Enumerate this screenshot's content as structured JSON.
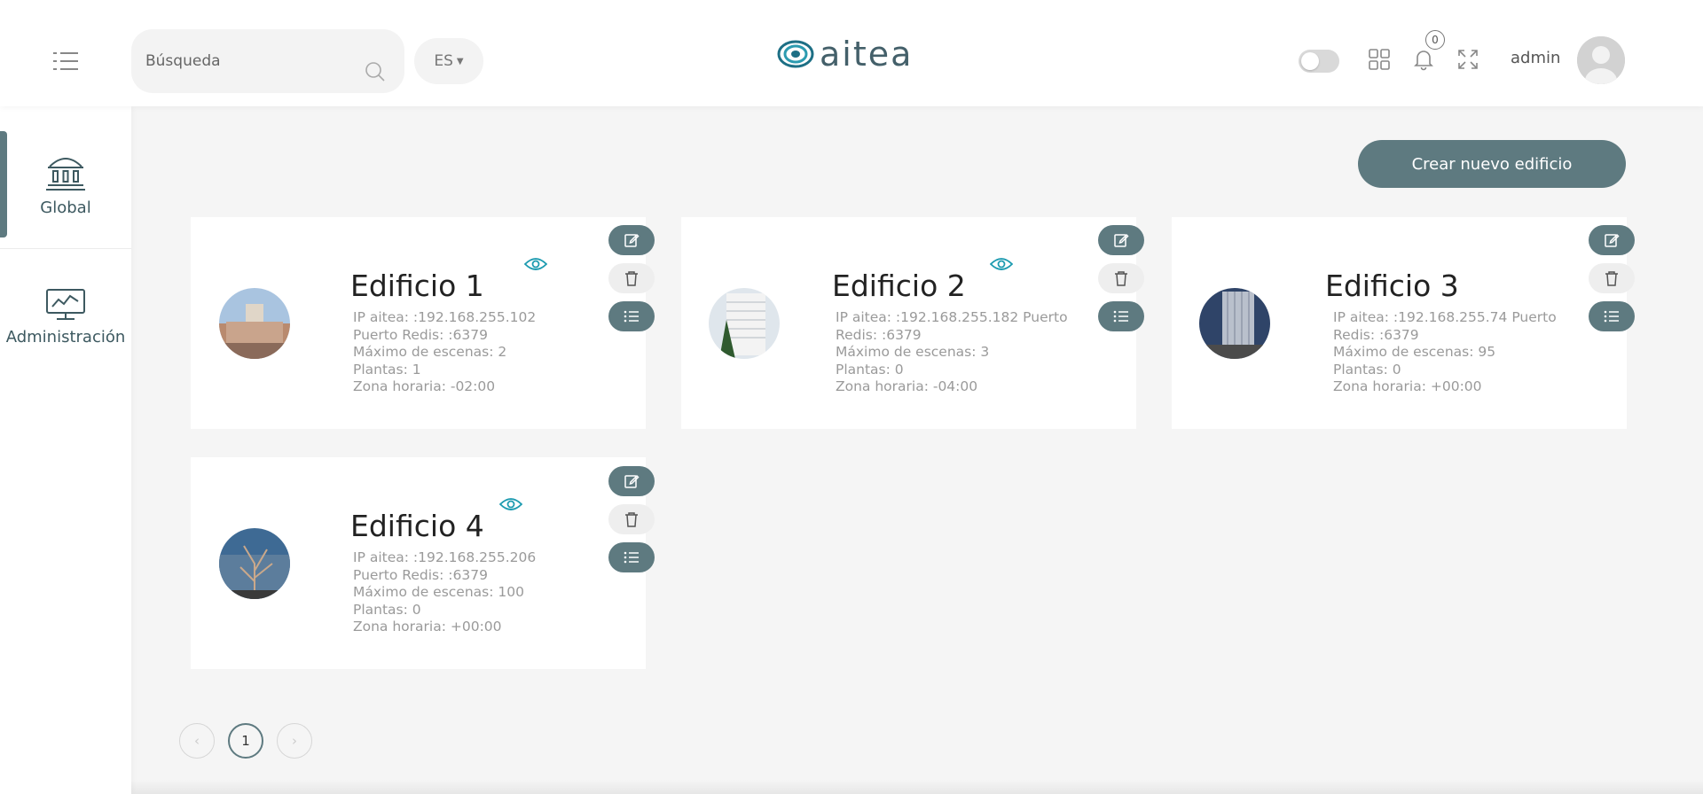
{
  "header": {
    "search": {
      "placeholder": "Búsqueda",
      "value": ""
    },
    "language": "ES",
    "logo_text": "aitea",
    "notifications_count": "0",
    "user_name": "admin",
    "icons": [
      "menu-toggle-icon",
      "search-icon",
      "caret-down-icon",
      "apps-grid-icon",
      "bell-icon",
      "fullscreen-icon",
      "user-avatar"
    ]
  },
  "sidebar": {
    "items": [
      {
        "label": "Global",
        "icon": "building-icon",
        "active": true
      },
      {
        "label": "Administración",
        "icon": "monitor-chart-icon",
        "active": false
      }
    ]
  },
  "main": {
    "create_button": "Crear nuevo edificio",
    "buildings": [
      {
        "name": "Edificio 1",
        "ip_line": "IP aitea: :192.168.255.102   Puerto Redis: :6379",
        "max_scenes": "Máximo de escenas: 2",
        "floors": "Plantas: 1",
        "timezone": "Zona horaria: -02:00"
      },
      {
        "name": "Edificio 2",
        "ip_line": "IP aitea: :192.168.255.182   Puerto Redis: :6379",
        "max_scenes": "Máximo de escenas: 3",
        "floors": "Plantas: 0",
        "timezone": "Zona horaria: -04:00"
      },
      {
        "name": "Edificio 3",
        "ip_line": "IP aitea: :192.168.255.74   Puerto Redis: :6379",
        "max_scenes": "Máximo de escenas: 95",
        "floors": "Plantas: 0",
        "timezone": "Zona horaria: +00:00"
      },
      {
        "name": "Edificio 4",
        "ip_line": "IP aitea: :192.168.255.206   Puerto Redis: :6379",
        "max_scenes": "Máximo de escenas: 100",
        "floors": "Plantas: 0",
        "timezone": "Zona horaria: +00:00"
      }
    ],
    "card_actions": [
      "edit-icon",
      "trash-icon",
      "list-icon"
    ]
  },
  "pagination": {
    "current_page": "1",
    "prev": "‹",
    "next": "›"
  },
  "colors": {
    "primary": "#5e7a80",
    "accent": "#1d9bb0",
    "background": "#f5f5f5"
  }
}
